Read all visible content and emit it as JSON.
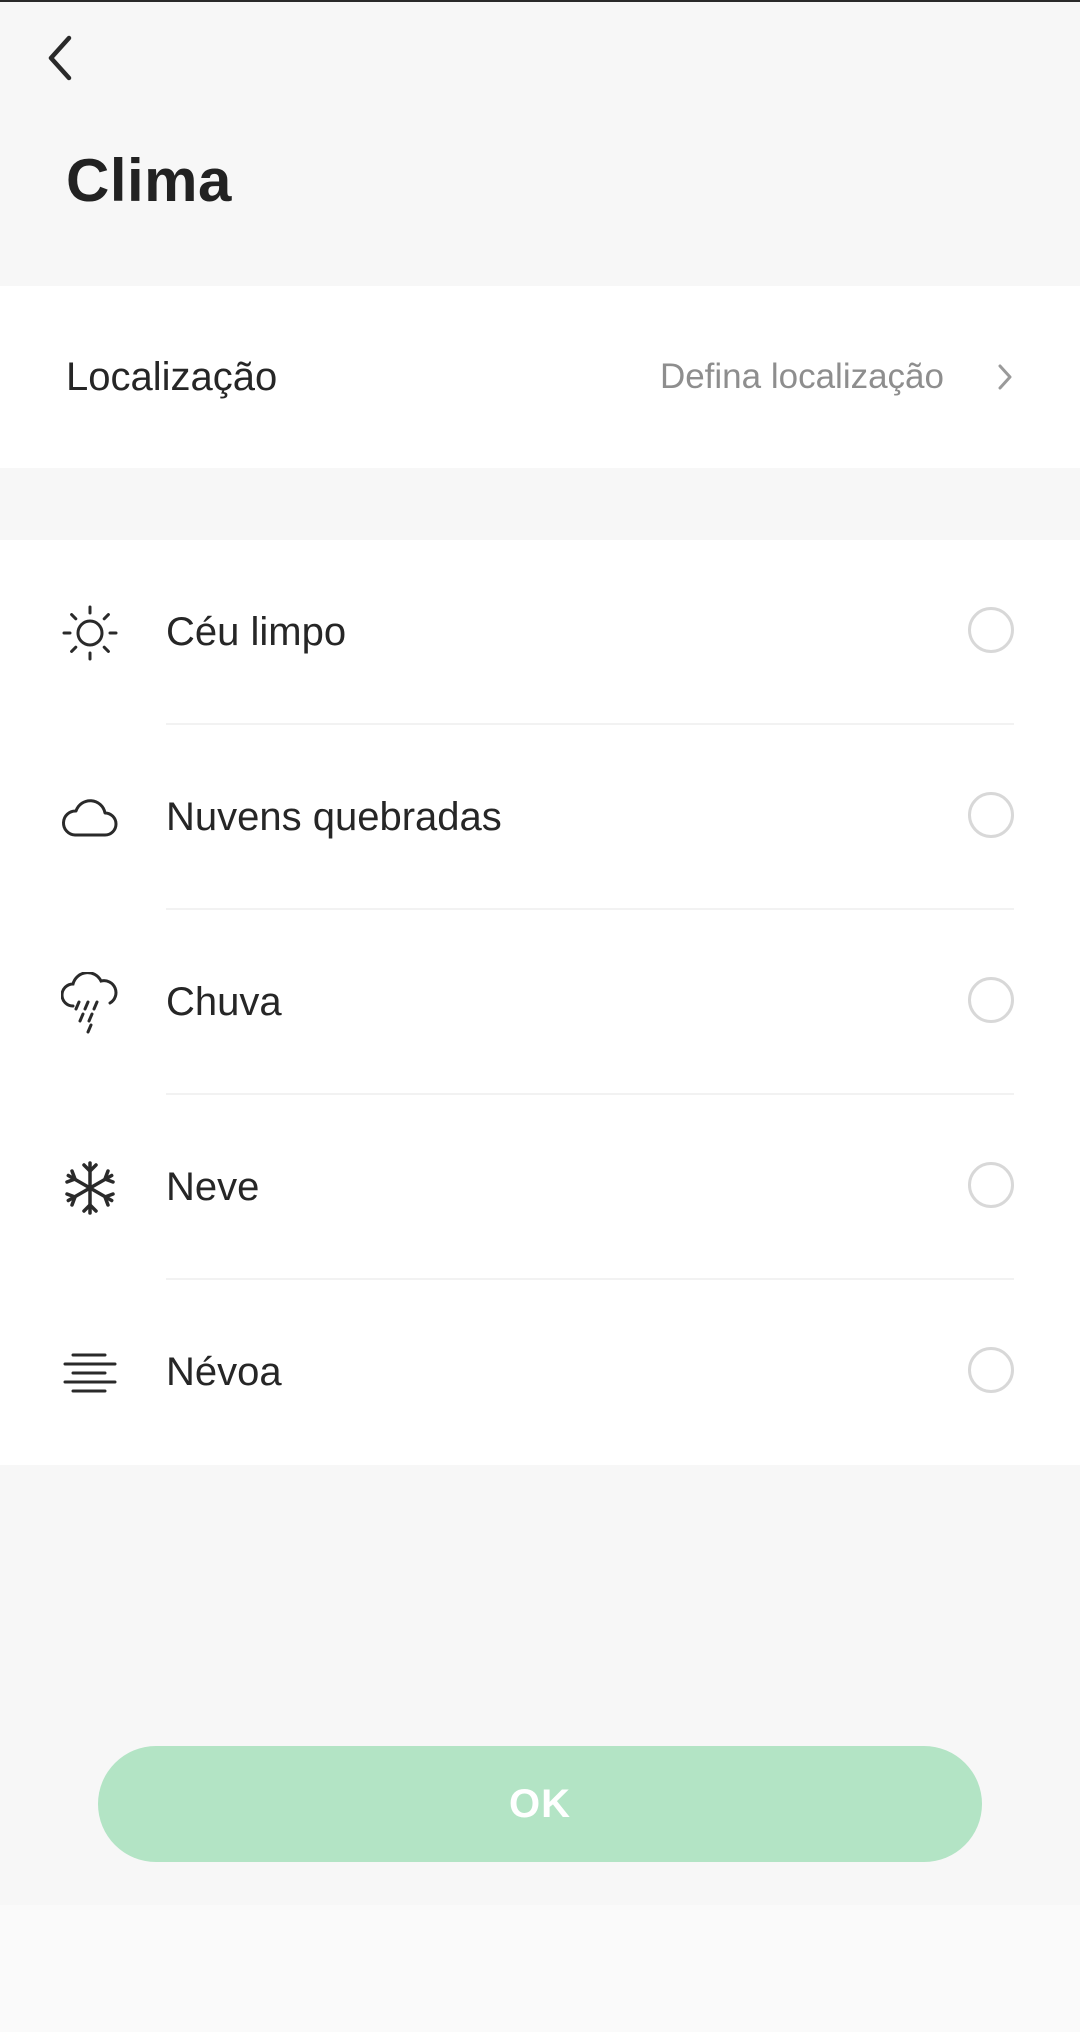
{
  "header": {
    "title": "Clima",
    "back_icon": "back-arrow-icon"
  },
  "location": {
    "label": "Localização",
    "value": "Defina localização",
    "chevron_icon": "chevron-right-icon"
  },
  "weather_options": [
    {
      "label": "Céu limpo",
      "icon": "sun-icon",
      "selected": false
    },
    {
      "label": "Nuvens quebradas",
      "icon": "cloud-icon",
      "selected": false
    },
    {
      "label": "Chuva",
      "icon": "rain-icon",
      "selected": false
    },
    {
      "label": "Neve",
      "icon": "snowflake-icon",
      "selected": false
    },
    {
      "label": "Névoa",
      "icon": "fog-icon",
      "selected": false
    }
  ],
  "ok_button": {
    "label": "OK",
    "enabled": false
  },
  "colors": {
    "background": "#f7f7f7",
    "card": "#ffffff",
    "text": "#262626",
    "secondary_text": "#8e8e8e",
    "button_disabled": "#b3e4c5",
    "radio_border": "#d8d8d8"
  }
}
